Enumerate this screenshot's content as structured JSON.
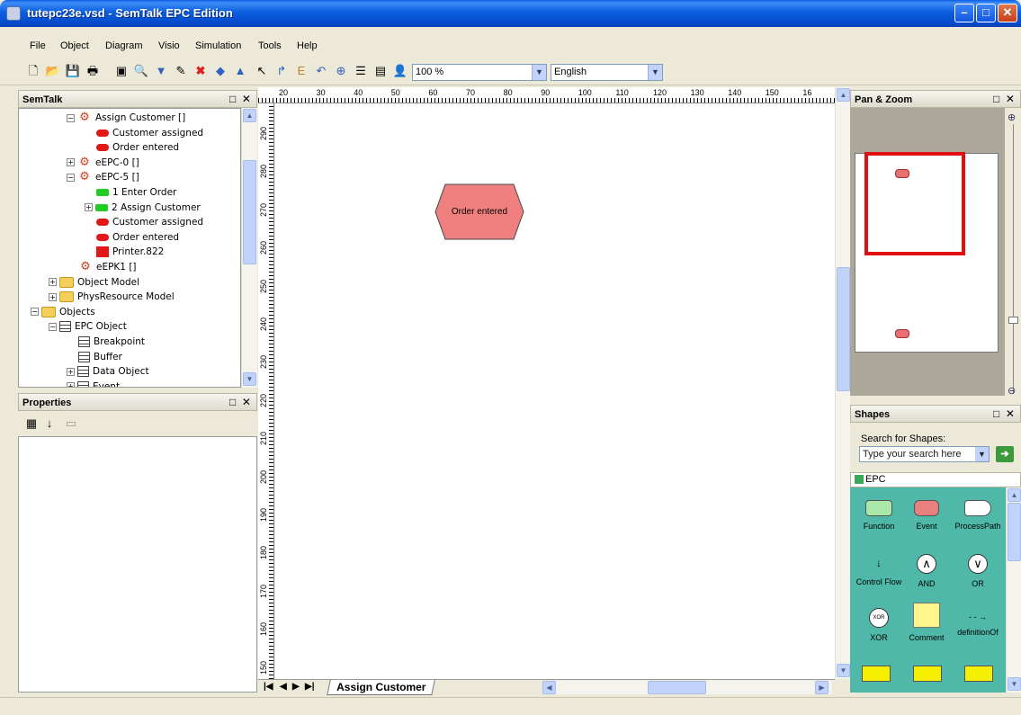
{
  "window": {
    "title": "tutepc23e.vsd - SemTalk EPC Edition"
  },
  "menu": [
    "File",
    "Object",
    "Diagram",
    "Visio",
    "Simulation",
    "Tools",
    "Help"
  ],
  "toolbar": {
    "zoom": "100 %",
    "language": "English"
  },
  "semtalk_panel": {
    "title": "SemTalk",
    "tree": [
      {
        "label": "Assign Customer []",
        "icon": "epc",
        "indent": 2,
        "expander": "−"
      },
      {
        "label": "Customer assigned",
        "icon": "event",
        "indent": 3
      },
      {
        "label": "Order entered",
        "icon": "event",
        "indent": 3
      },
      {
        "label": "eEPC-0 []",
        "icon": "epc",
        "indent": 2,
        "expander": "+"
      },
      {
        "label": "eEPC-5 []",
        "icon": "epc",
        "indent": 2,
        "expander": "−"
      },
      {
        "label": "1 Enter Order",
        "icon": "func",
        "indent": 3
      },
      {
        "label": "2 Assign Customer",
        "icon": "func",
        "indent": 3,
        "expander": "+"
      },
      {
        "label": "Customer assigned",
        "icon": "event",
        "indent": 3
      },
      {
        "label": "Order entered",
        "icon": "event",
        "indent": 3
      },
      {
        "label": "Printer.822",
        "icon": "res",
        "indent": 3
      },
      {
        "label": "eEPK1 []",
        "icon": "epc",
        "indent": 2
      },
      {
        "label": "Object Model",
        "icon": "folder",
        "indent": 1,
        "expander": "+"
      },
      {
        "label": "PhysResource Model",
        "icon": "folder",
        "indent": 1,
        "expander": "+"
      },
      {
        "label": "Objects",
        "icon": "folder",
        "indent": 0,
        "expander": "−"
      },
      {
        "label": "EPC Object",
        "icon": "obj",
        "indent": 1,
        "expander": "−"
      },
      {
        "label": "Breakpoint",
        "icon": "obj",
        "indent": 2
      },
      {
        "label": "Buffer",
        "icon": "obj",
        "indent": 2
      },
      {
        "label": "Data Object",
        "icon": "obj",
        "indent": 2,
        "expander": "+"
      },
      {
        "label": "Event",
        "icon": "obj",
        "indent": 2,
        "expander": "+"
      }
    ]
  },
  "properties_panel": {
    "title": "Properties"
  },
  "rulers": {
    "horizontal": [
      "20",
      "30",
      "40",
      "50",
      "60",
      "70",
      "80",
      "90",
      "100",
      "110",
      "120",
      "130",
      "140",
      "150",
      "16"
    ],
    "vertical": [
      "290",
      "280",
      "270",
      "260",
      "250",
      "240",
      "230",
      "220",
      "210",
      "200",
      "190",
      "180",
      "170",
      "160",
      "150"
    ]
  },
  "canvas": {
    "shape_label": "Order entered",
    "shape_fill": "#f08080"
  },
  "page_tab": "Assign Customer",
  "pan_zoom_panel": {
    "title": "Pan & Zoom"
  },
  "shapes_panel": {
    "title": "Shapes",
    "search_label": "Search for Shapes:",
    "search_placeholder": "Type your search here",
    "stencil_name": "EPC",
    "masters": [
      "Function",
      "Event",
      "ProcessPath",
      "Control Flow",
      "AND",
      "OR",
      "XOR",
      "Comment",
      "definitionOf"
    ]
  },
  "colors": {
    "accent": "#0a5ce4",
    "selection": "#e01010",
    "stencil_bg": "#4fb8a8"
  }
}
